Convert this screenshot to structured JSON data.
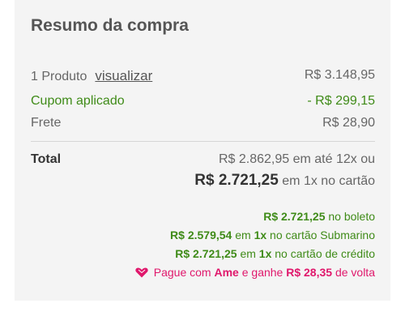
{
  "summary": {
    "title": "Resumo da compra",
    "products_label": "1 Produto",
    "view_link": "visualizar",
    "products_value": "R$ 3.148,95",
    "coupon_label": "Cupom aplicado",
    "coupon_value": "- R$ 299,15",
    "shipping_label": "Frete",
    "shipping_value": "R$ 28,90",
    "total_label": "Total",
    "installment_text": "R$ 2.862,95 em até 12x ou",
    "total_value": "R$ 2.721,25",
    "total_suffix": "em 1x no cartão"
  },
  "payment_options": {
    "boleto_value": "R$ 2.721,25",
    "boleto_text": "no boleto",
    "submarino_value": "R$ 2.579,54",
    "submarino_em": "em",
    "submarino_1x": "1x",
    "submarino_text": "no cartão Submarino",
    "credit_value": "R$ 2.721,25",
    "credit_em": "em",
    "credit_1x": "1x",
    "credit_text": "no cartão de crédito",
    "ame_pre": "Pague com",
    "ame_brand": "Ame",
    "ame_mid": "e ganhe",
    "ame_value": "R$ 28,35",
    "ame_post": "de volta"
  },
  "colors": {
    "green": "#3f8b18",
    "ame_pink": "#e0186c"
  }
}
